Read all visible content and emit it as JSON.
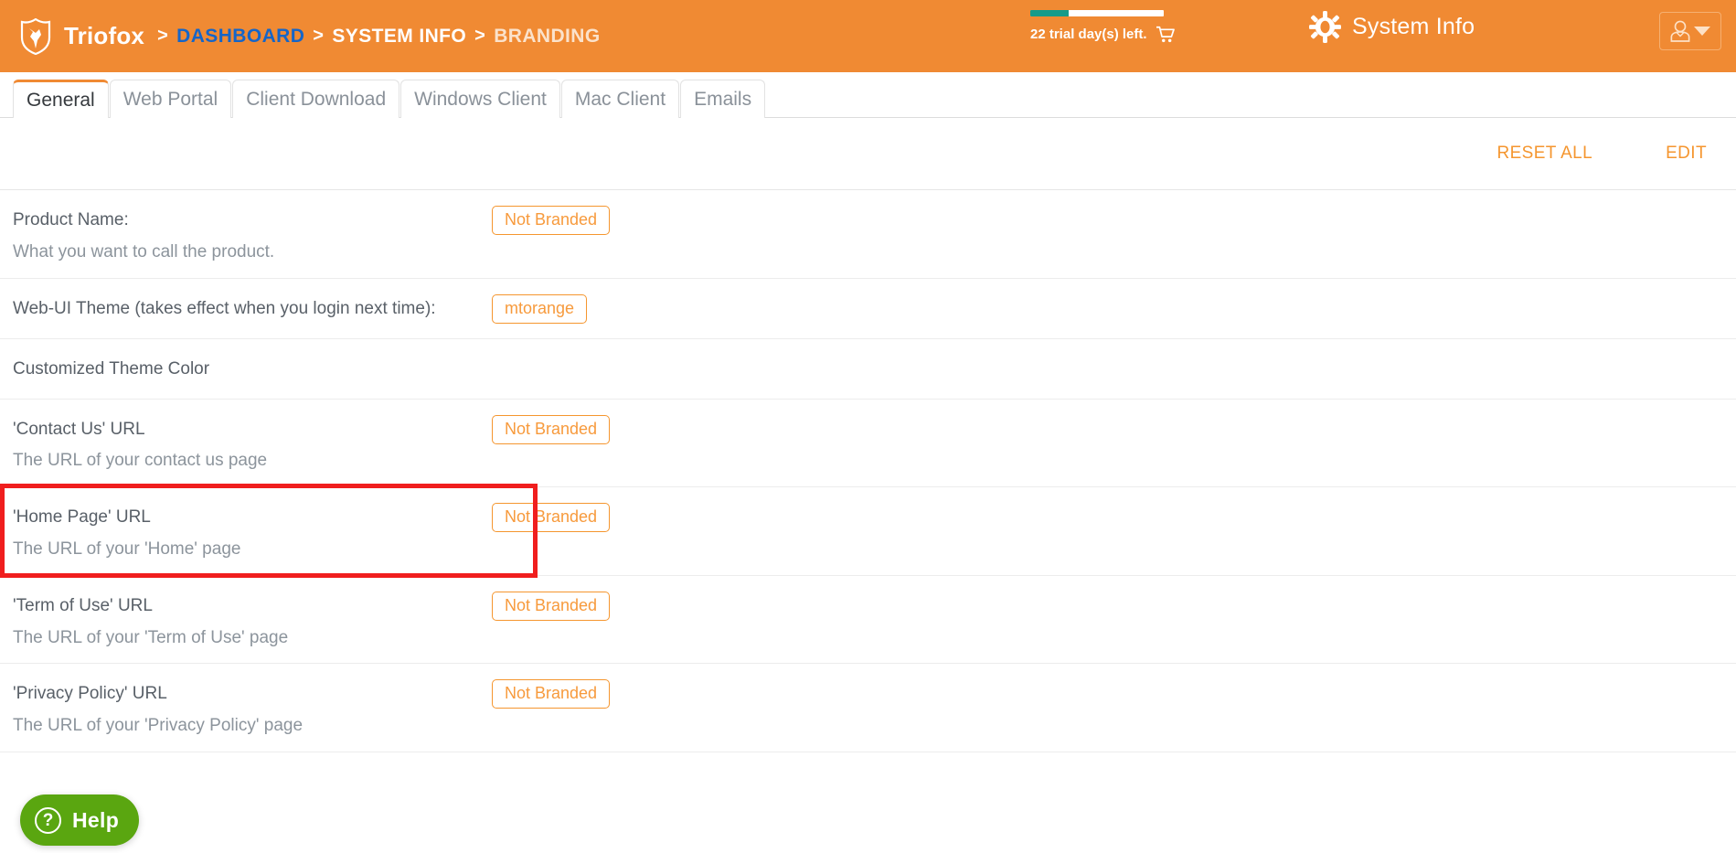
{
  "header": {
    "brand": "Triofox",
    "logo_icon": "shield-fox-logo",
    "breadcrumb": [
      {
        "label": "DASHBOARD",
        "style": "link"
      },
      {
        "label": "SYSTEM INFO",
        "style": "plain"
      },
      {
        "label": "BRANDING",
        "style": "dim"
      }
    ],
    "breadcrumb_separator": ">",
    "trial": {
      "text": "22 trial day(s) left.",
      "progress_percent": 29,
      "cart_icon": "shopping-cart-icon",
      "bar_fill_color": "#169b8a",
      "bar_track_color": "#ffffff"
    },
    "system_info": {
      "label": "System Info",
      "icon": "gear-icon"
    },
    "user_menu": {
      "icon": "user-avatar-icon",
      "caret_icon": "chevron-down-icon"
    },
    "background_color": "#f08a33"
  },
  "tabs": [
    {
      "label": "General",
      "active": true
    },
    {
      "label": "Web Portal",
      "active": false
    },
    {
      "label": "Client Download",
      "active": false
    },
    {
      "label": "Windows Client",
      "active": false
    },
    {
      "label": "Mac Client",
      "active": false
    },
    {
      "label": "Emails",
      "active": false
    }
  ],
  "actions": {
    "reset_all": "RESET ALL",
    "edit": "EDIT",
    "accent_color": "#f5962f"
  },
  "settings": [
    {
      "title": "Product Name:",
      "description": "What you want to call the product.",
      "badge": "Not Branded"
    },
    {
      "title": "Web-UI Theme (takes effect when you login next time):",
      "description": "",
      "badge": "mtorange"
    },
    {
      "title": "Customized Theme Color",
      "description": "",
      "badge": ""
    },
    {
      "title": "'Contact Us' URL",
      "description": "The URL of your contact us page",
      "badge": "Not Branded"
    },
    {
      "title": "'Home Page' URL",
      "description": "The URL of your 'Home' page",
      "badge": "Not Branded",
      "highlighted": true
    },
    {
      "title": "'Term of Use' URL",
      "description": "The URL of your 'Term of Use' page",
      "badge": "Not Branded"
    },
    {
      "title": "'Privacy Policy' URL",
      "description": "The URL of your 'Privacy Policy' page",
      "badge": "Not Branded"
    }
  ],
  "annotation": {
    "color": "#f01e1e",
    "target": "'Home Page' URL row"
  },
  "help_widget": {
    "label": "Help",
    "icon": "question-mark-circle-icon",
    "glyph": "?",
    "color": "#5aa610"
  }
}
